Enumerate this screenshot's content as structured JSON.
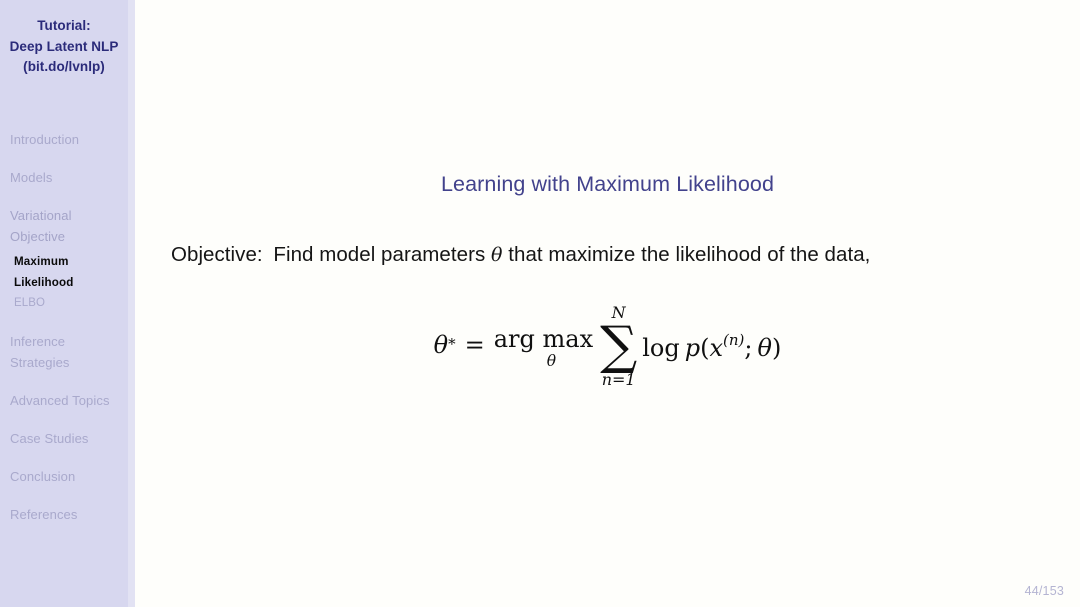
{
  "sidebar": {
    "title_lines": [
      "Tutorial:",
      "Deep Latent NLP",
      "(bit.do/lvnlp)"
    ],
    "sections": [
      {
        "label": "Introduction",
        "active": false,
        "subsections": []
      },
      {
        "label": "Models",
        "active": false,
        "subsections": []
      },
      {
        "label": "Variational Objective",
        "active": true,
        "subsections": [
          {
            "label": "Maximum Likelihood",
            "active": true
          },
          {
            "label": "ELBO",
            "active": false
          }
        ]
      },
      {
        "label": "Inference Strategies",
        "active": false,
        "subsections": []
      },
      {
        "label": "Advanced Topics",
        "active": false,
        "subsections": []
      },
      {
        "label": "Case Studies",
        "active": false,
        "subsections": []
      },
      {
        "label": "Conclusion",
        "active": false,
        "subsections": []
      },
      {
        "label": "References",
        "active": false,
        "subsections": []
      }
    ],
    "flat_items": [
      "Introduction",
      "Models",
      "Variational",
      "Objective",
      "Maximum Likelihood",
      "ELBO",
      "Inference",
      "Strategies",
      "Advanced Topics",
      "Case Studies",
      "Conclusion",
      "References"
    ]
  },
  "slide": {
    "title": "Learning with Maximum Likelihood",
    "body": {
      "objective_prefix": "Objective:",
      "objective_part1": "Find model parameters",
      "objective_symbol": "θ",
      "objective_part2": "that maximize the likelihood of the data,",
      "objective_full": "Objective: Find model parameters θ that maximize the likelihood of the data,"
    },
    "equation": {
      "plain": "θ* = arg max_θ ∑_{n=1}^{N} log p(x^{(n)}; θ)",
      "lhs_symbol": "θ",
      "lhs_superscript": "*",
      "equals": "=",
      "operator": "arg max",
      "operator_limit": "θ",
      "sum_glyph": "∑",
      "sum_upper": "N",
      "sum_lower": "n=1",
      "log": "log",
      "density": "p",
      "open_paren": "(",
      "variable": "x",
      "variable_superscript": "(n)",
      "semicolon": ";",
      "parameter": "θ",
      "close_paren": ")"
    }
  },
  "footer": {
    "page_number": "44/153"
  },
  "colors": {
    "sidebar_bg": "#d7d7ef",
    "sidebar_edge": "#e2e2f3",
    "sidebar_title": "#2b2b7a",
    "sidebar_inactive": "#a9a9cc",
    "sidebar_active": "#0a0a0a",
    "slide_bg": "#fefefb",
    "title_accent": "#42428c",
    "body_text": "#151515",
    "page_number": "#b4b4d2"
  }
}
